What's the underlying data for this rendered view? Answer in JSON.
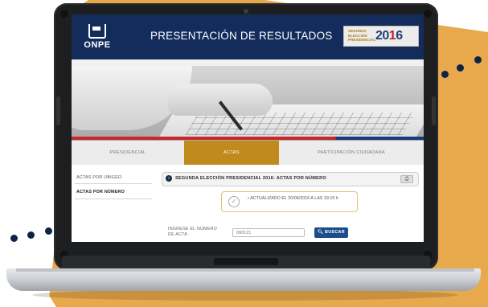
{
  "colors": {
    "background_orange": "#e7a94c",
    "dots_navy": "#0f2347",
    "header_navy": "#132c5c",
    "active_tab_gold": "#c08a1d",
    "button_blue": "#1c4c8c"
  },
  "header": {
    "logo_text": "ONPE",
    "title": "PRESENTACIÓN DE RESULTADOS",
    "badge_line1": "SEGUNDA",
    "badge_line2": "ELECCIÓN",
    "badge_line3": "PRESIDENCIAL",
    "badge_year_a": "20",
    "badge_year_b": "1",
    "badge_year_c": "6"
  },
  "tabs": [
    {
      "label": "PRESIDENCIAL",
      "active": false
    },
    {
      "label": "ACTAS",
      "active": true
    },
    {
      "label": "PARTICIPACIÓN CIUDADANA",
      "active": false
    }
  ],
  "sidebar": {
    "items": [
      {
        "label": "ACTAS POR UBIGEO"
      },
      {
        "label": "ACTAS POR NÚMERO"
      }
    ]
  },
  "section": {
    "title": "SEGUNDA ELECCIÓN PRESIDENCIAL 2016: ACTAS POR NÚMERO",
    "collapse_icon": "chevron-icon",
    "print_icon": "printer-icon"
  },
  "status": {
    "updated_text": "ACTUALIZADO EL 20/06/2016 A LAS 19:15 h",
    "icon": "check-icon"
  },
  "search": {
    "label": "INGRESE EL NÚMERO DE ACTA",
    "input_value": "000121",
    "button_label": "BUSCAR",
    "button_icon": "search-icon"
  }
}
